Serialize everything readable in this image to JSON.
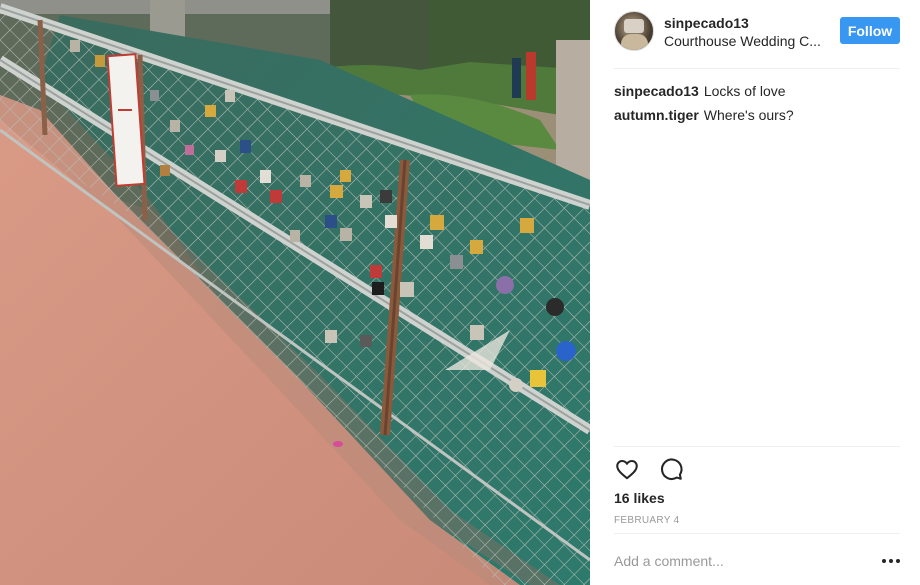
{
  "post": {
    "photo": {
      "alt": "Padlocks attached to a chain-link fence along the river walk"
    },
    "author": {
      "username": "sinpecado13",
      "location": "Courthouse Wedding C..."
    },
    "follow_label": "Follow",
    "comments": [
      {
        "author": "sinpecado13",
        "text": "Locks of love"
      },
      {
        "author": "autumn.tiger",
        "text": "Where's ours?"
      }
    ],
    "actions": [
      {
        "name": "like-icon"
      },
      {
        "name": "comment-icon"
      }
    ],
    "likes_text": "16 likes",
    "timestamp": "FEBRUARY 4",
    "comment_input": {
      "placeholder": "Add a comment...",
      "value": ""
    },
    "more_icon": "more-options-icon",
    "colors": {
      "accent": "#3897f0",
      "text": "#262626",
      "muted": "#999999",
      "divider": "#efefef"
    }
  }
}
